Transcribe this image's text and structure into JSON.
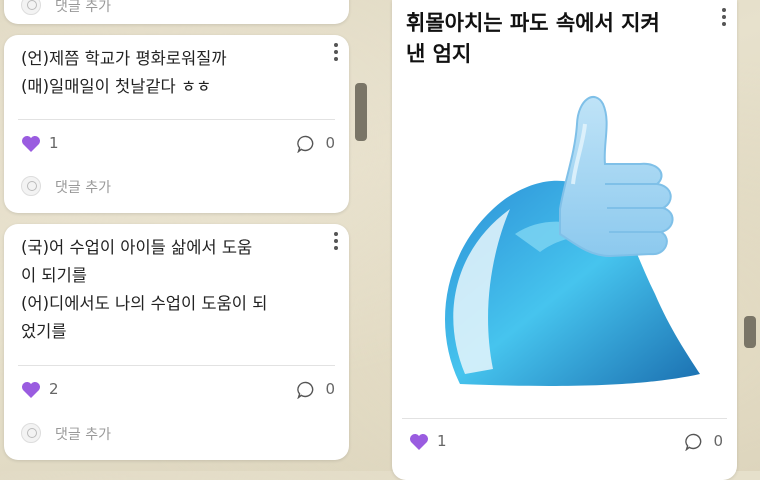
{
  "top_card": {
    "add_comment_label": "댓글 추가"
  },
  "card1": {
    "text": "(언)제쯤 학교가 평화로워질까\n(매)일매일이 첫날같다 ㅎㅎ",
    "likes": "1",
    "comments": "0",
    "add_comment_label": "댓글 추가"
  },
  "card2": {
    "text": "(국)어 수업이 아이들 삶에서 도움\n이 되기를\n(어)디에서도 나의 수업이 도움이 되\n었기를",
    "likes": "2",
    "comments": "0",
    "add_comment_label": "댓글 추가"
  },
  "card3": {
    "title": "휘몰아치는 파도 속에서 지켜\n낸 엄지",
    "likes": "1",
    "comments": "0",
    "image": "thumbs-up-wave-illustration"
  },
  "colors": {
    "heart": "#9a5ce0",
    "wave_dark": "#1b6fb0",
    "wave_light": "#5fd0f0"
  }
}
